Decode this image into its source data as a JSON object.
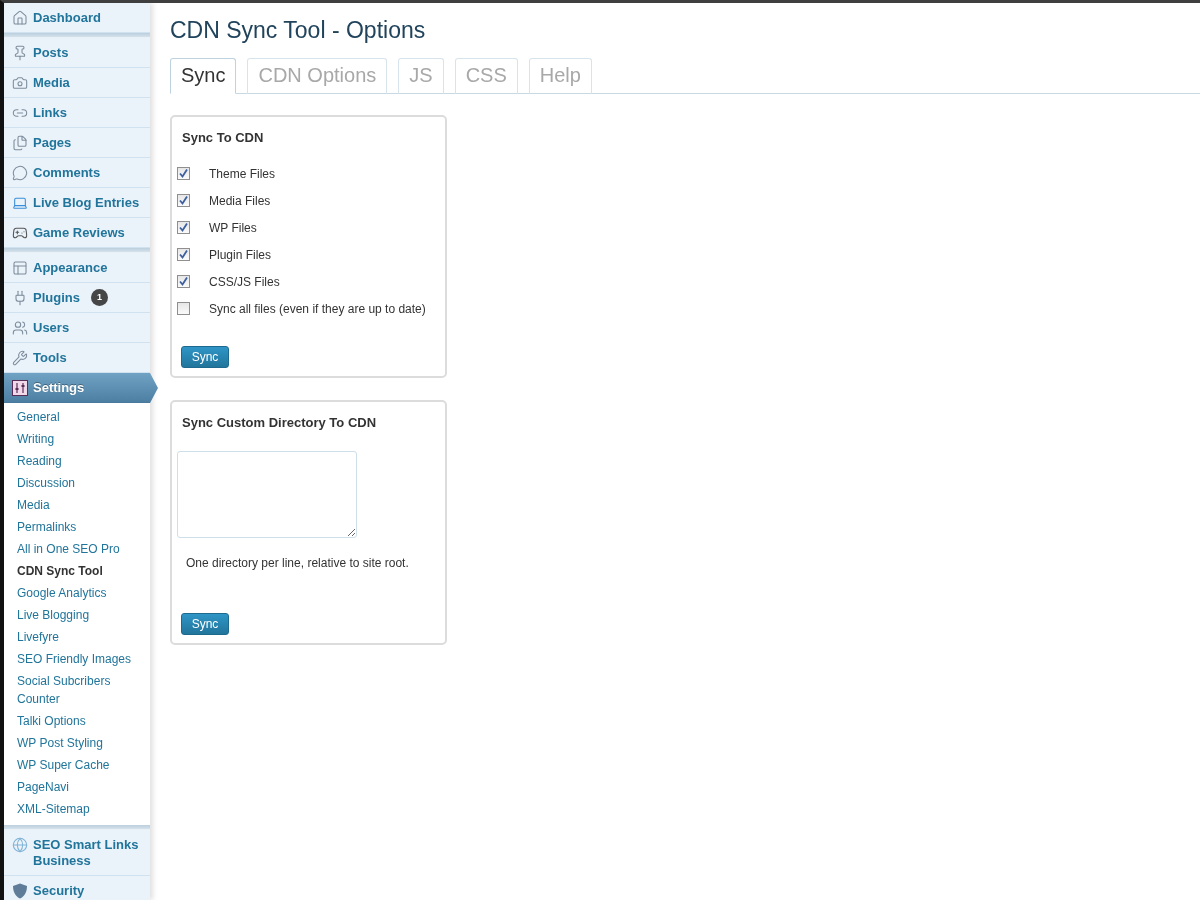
{
  "sidebar": {
    "groups": [
      {
        "items": [
          {
            "label": "Dashboard",
            "selected": false
          }
        ]
      },
      {
        "items": [
          {
            "label": "Posts",
            "selected": false
          },
          {
            "label": "Media",
            "selected": false
          },
          {
            "label": "Links",
            "selected": false
          },
          {
            "label": "Pages",
            "selected": false
          },
          {
            "label": "Comments",
            "selected": false
          },
          {
            "label": "Live Blog Entries",
            "selected": false
          },
          {
            "label": "Game Reviews",
            "selected": false
          }
        ]
      },
      {
        "items": [
          {
            "label": "Appearance",
            "selected": false
          },
          {
            "label": "Plugins",
            "selected": false,
            "badge": "1"
          },
          {
            "label": "Users",
            "selected": false
          },
          {
            "label": "Tools",
            "selected": false
          },
          {
            "label": "Settings",
            "selected": true,
            "submenu": [
              {
                "label": "General",
                "selected": false
              },
              {
                "label": "Writing",
                "selected": false
              },
              {
                "label": "Reading",
                "selected": false
              },
              {
                "label": "Discussion",
                "selected": false
              },
              {
                "label": "Media",
                "selected": false
              },
              {
                "label": "Permalinks",
                "selected": false
              },
              {
                "label": "All in One SEO Pro",
                "selected": false
              },
              {
                "label": "CDN Sync Tool",
                "selected": true
              },
              {
                "label": "Google Analytics",
                "selected": false
              },
              {
                "label": "Live Blogging",
                "selected": false
              },
              {
                "label": "Livefyre",
                "selected": false
              },
              {
                "label": "SEO Friendly Images",
                "selected": false
              },
              {
                "label": "Social Subcribers Counter",
                "selected": false
              },
              {
                "label": "Talki Options",
                "selected": false
              },
              {
                "label": "WP Post Styling",
                "selected": false
              },
              {
                "label": "WP Super Cache",
                "selected": false
              },
              {
                "label": "PageNavi",
                "selected": false
              },
              {
                "label": "XML-Sitemap",
                "selected": false
              }
            ]
          }
        ]
      },
      {
        "items": [
          {
            "label": "SEO Smart Links Business",
            "selected": false
          },
          {
            "label": "Security",
            "selected": false
          }
        ]
      }
    ]
  },
  "page": {
    "title": "CDN Sync Tool - Options"
  },
  "tabs": [
    {
      "label": "Sync",
      "selected": true
    },
    {
      "label": "CDN Options",
      "selected": false
    },
    {
      "label": "JS",
      "selected": false
    },
    {
      "label": "CSS",
      "selected": false
    },
    {
      "label": "Help",
      "selected": false
    }
  ],
  "panels": [
    {
      "kind": "checkboxes",
      "heading": "Sync To CDN",
      "options": [
        {
          "label": "Theme Files",
          "checked": true
        },
        {
          "label": "Media Files",
          "checked": true
        },
        {
          "label": "WP Files",
          "checked": true
        },
        {
          "label": "Plugin Files",
          "checked": true
        },
        {
          "label": "CSS/JS Files",
          "checked": true
        },
        {
          "label": "Sync all files (even if they are up to date)",
          "checked": false
        }
      ],
      "button": "Sync"
    },
    {
      "kind": "directory",
      "heading": "Sync Custom Directory To CDN",
      "hint": "One directory per line, relative to site root.",
      "button": "Sync"
    }
  ]
}
